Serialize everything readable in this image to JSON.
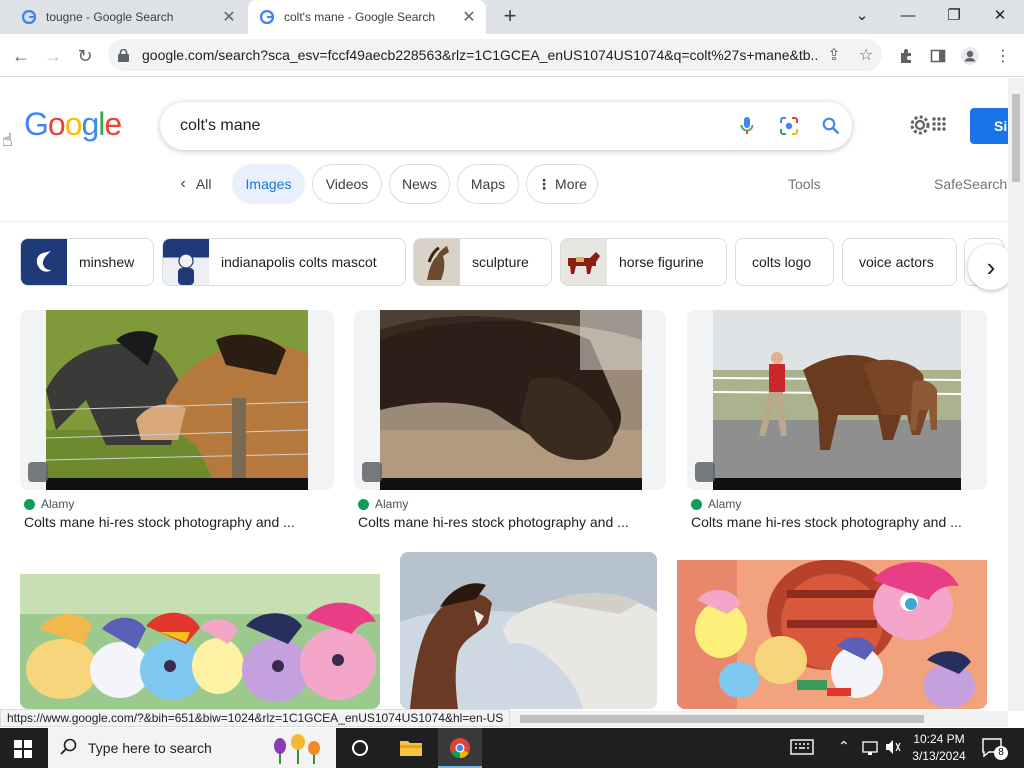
{
  "browser": {
    "tabs": [
      {
        "title": "tougne - Google Search",
        "active": false
      },
      {
        "title": "colt's mane - Google Search",
        "active": true
      }
    ],
    "url": "google.com/search?sca_esv=fccf49aecb228563&rlz=1C1GCEA_enUS1074US1074&q=colt%27s+mane&tb..."
  },
  "google": {
    "logo": "Google",
    "query": "colt's mane",
    "signin_label": "Si",
    "tabs": [
      {
        "label": "All"
      },
      {
        "label": "Images"
      },
      {
        "label": "Videos"
      },
      {
        "label": "News"
      },
      {
        "label": "Maps"
      },
      {
        "label": "More"
      }
    ],
    "tools_label": "Tools",
    "safesearch_label": "SafeSearch"
  },
  "related": [
    {
      "label": "minshew"
    },
    {
      "label": "indianapolis colts mascot"
    },
    {
      "label": "sculpture"
    },
    {
      "label": "horse figurine"
    },
    {
      "label": "colts logo"
    },
    {
      "label": "voice actors"
    }
  ],
  "results": [
    {
      "source": "Alamy",
      "title": "Colts mane hi-res stock photography and ..."
    },
    {
      "source": "Alamy",
      "title": "Colts mane hi-res stock photography and ..."
    },
    {
      "source": "Alamy",
      "title": "Colts mane hi-res stock photography and ..."
    }
  ],
  "status_url": "https://www.google.com/?&bih=651&biw=1024&rlz=1C1GCEA_enUS1074US1074&hl=en-US",
  "taskbar": {
    "search_placeholder": "Type here to search",
    "time": "10:24 PM",
    "date": "3/13/2024",
    "notification_count": "8"
  },
  "colors": {
    "accent": "#1a73e8",
    "chip_active_bg": "#e8f0fe",
    "taskbar": "#1f1f1f"
  }
}
